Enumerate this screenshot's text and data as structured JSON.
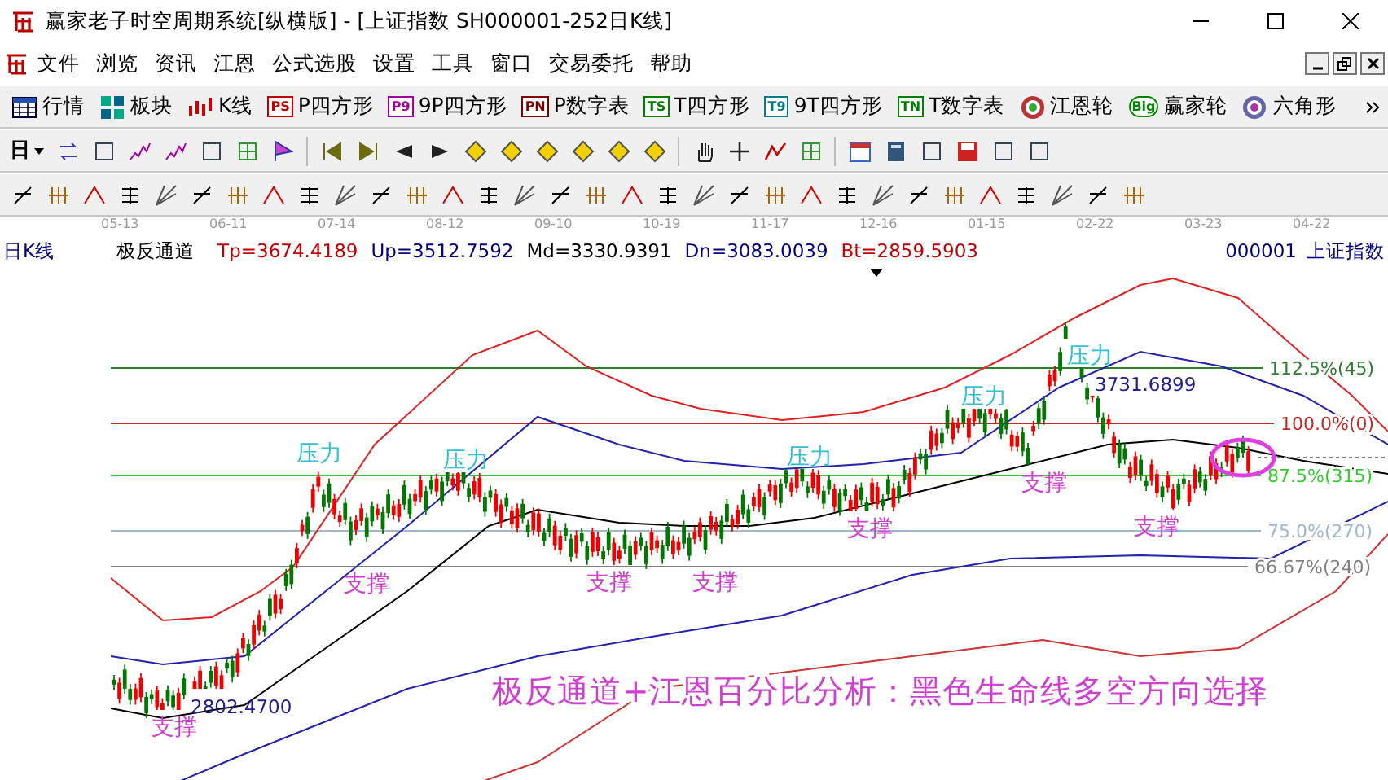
{
  "window": {
    "title": "赢家老子时空周期系统[纵横版] - [上证指数  SH000001-252日K线]"
  },
  "menu": [
    "文件",
    "浏览",
    "资讯",
    "江恩",
    "公式选股",
    "设置",
    "工具",
    "窗口",
    "交易委托",
    "帮助"
  ],
  "toolbar": [
    {
      "kind": "table",
      "label": "行情"
    },
    {
      "kind": "blocks",
      "label": "板块"
    },
    {
      "kind": "candles",
      "label": "K线"
    },
    {
      "kind": "badge",
      "badge": "PS",
      "color": "#c00000",
      "label": "P四方形"
    },
    {
      "kind": "badge",
      "badge": "P9",
      "color": "#a000a0",
      "label": "9P四方形"
    },
    {
      "kind": "badge",
      "badge": "PN",
      "color": "#800000",
      "label": "P数字表"
    },
    {
      "kind": "badge",
      "badge": "TS",
      "color": "#008000",
      "label": "T四方形"
    },
    {
      "kind": "badge",
      "badge": "T9",
      "color": "#008080",
      "label": "9T四方形"
    },
    {
      "kind": "badge",
      "badge": "TN",
      "color": "#008000",
      "label": "T数字表"
    },
    {
      "kind": "wheel",
      "label": "江恩轮"
    },
    {
      "kind": "big",
      "badge": "Big",
      "label": "赢家轮"
    },
    {
      "kind": "hexagon",
      "label": "六角形"
    }
  ],
  "period_selector": "日",
  "date_axis": [
    "05-13",
    "06-11",
    "07-14",
    "08-12",
    "09-10",
    "10-19",
    "11-17",
    "12-16",
    "01-15",
    "02-22",
    "03-23",
    "04-22"
  ],
  "info": {
    "period": "日K线",
    "indicator": "极反通道",
    "values": [
      {
        "text": "Tp=3674.4189",
        "color": "#c00000"
      },
      {
        "text": "Up=3512.7592",
        "color": "#000080"
      },
      {
        "text": "Md=3330.9391",
        "color": "#000000"
      },
      {
        "text": "Dn=3083.0039",
        "color": "#000080"
      },
      {
        "text": "Bt=2859.5903",
        "color": "#c00000"
      }
    ],
    "code": "000001",
    "name": "上证指数"
  },
  "chart": {
    "levels": [
      {
        "label": "112.5%(45)",
        "color": "#2e7d32"
      },
      {
        "label": "100.0%(0)",
        "color": "#c62828"
      },
      {
        "label": "87.5%(315)",
        "color": "#33cc33"
      },
      {
        "label": "75.0%(270)",
        "color": "#9fb8d0"
      },
      {
        "label": "66.67%(240)",
        "color": "#808080"
      }
    ],
    "annotations": [
      {
        "kind": "pressure",
        "text": "压力"
      },
      {
        "kind": "pressure",
        "text": "压力"
      },
      {
        "kind": "pressure",
        "text": "压力"
      },
      {
        "kind": "pressure",
        "text": "压力"
      },
      {
        "kind": "pressure",
        "text": "压力"
      },
      {
        "kind": "price",
        "text": "3731.6899"
      },
      {
        "kind": "support",
        "text": "支撑"
      },
      {
        "kind": "support",
        "text": "支撑"
      },
      {
        "kind": "support",
        "text": "支撑"
      },
      {
        "kind": "support",
        "text": "支撑"
      },
      {
        "kind": "support",
        "text": "支撑"
      },
      {
        "kind": "support",
        "text": "支撑"
      },
      {
        "kind": "price",
        "text": "2802.4700"
      },
      {
        "kind": "support",
        "text": "支撑"
      }
    ],
    "caption": "极反通道+江恩百分比分析：黑色生命线多空方向选择"
  }
}
